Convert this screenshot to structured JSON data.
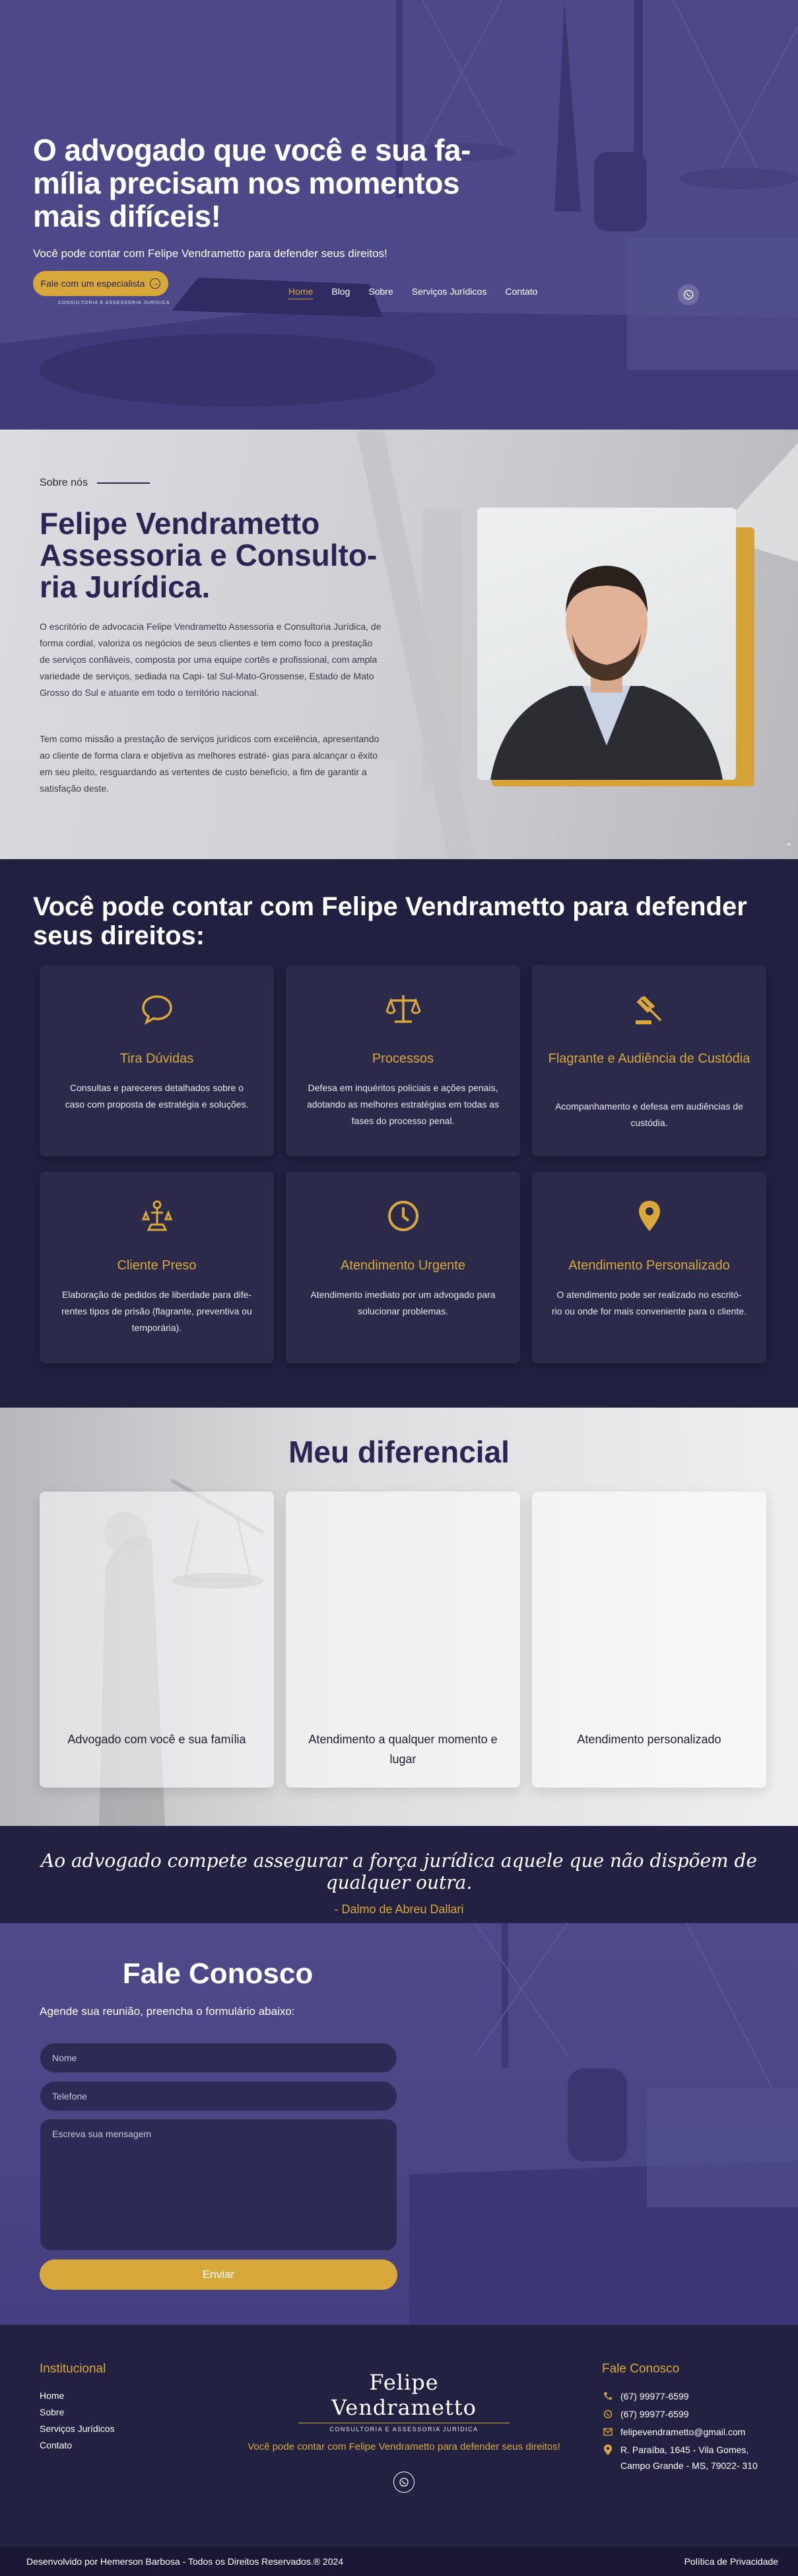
{
  "hero": {
    "title": "O advogado que você e sua fa- mília precisam nos momentos mais difíceis!",
    "subtitle": "Você pode contar com Felipe Vendrametto para defender seus direitos!",
    "cta": "Fale com um especialista",
    "logo_tagline": "CONSULTORIA E ASSESSORIA JURÍDICA",
    "nav": [
      "Home",
      "Blog",
      "Sobre",
      "Serviços Jurídicos",
      "Contato"
    ]
  },
  "about": {
    "label": "Sobre nós",
    "title": "Felipe Vendrametto Assessoria e Consulto- ria Jurídica.",
    "p1": "O escritório de advocacia Felipe Vendrametto Assessoria e Consultoria Jurídica, de forma cordial, valoriza os negócios de seus clientes e tem como foco a prestação de serviços confiáveis, composta por uma equipe cortês e profissional, com ampla variedade de serviços, sediada na Capi- tal Sul-Mato-Grossense, Estado de Mato Grosso do Sul e atuante em todo o território nacional.",
    "p2": "Tem como missão a prestação de serviços jurídicos com excelência, apresentando ao cliente de forma clara e objetiva as melhores estraté- gias para alcançar o êxito em seu pleito, resguardando as vertentes de custo benefício, a fim de garantir a satisfação deste."
  },
  "services": {
    "title": "Você pode contar com Felipe Vendrametto para defender seus direitos:",
    "items": [
      {
        "icon": "chat-bubble-icon",
        "title": "Tira Dúvidas",
        "desc": "Consultas e pareceres detalhados sobre o caso com proposta de estratégia e soluções."
      },
      {
        "icon": "scales-icon",
        "title": "Processos",
        "desc": "Defesa em inquéritos policiais e ações penais, adotando as melhores estratégias em todas as fases do processo penal."
      },
      {
        "icon": "gavel-icon",
        "title": "Flagrante e Audiência de Custódia",
        "desc": "Acompanhamento e defesa em audiências de custódia."
      },
      {
        "icon": "justice-figure-icon",
        "title": "Cliente Preso",
        "desc": "Elaboração de pedidos de liberdade para dife- rentes tipos de prisão (flagrante, preventiva ou temporária)."
      },
      {
        "icon": "clock-icon",
        "title": "Atendimento Urgente",
        "desc": "Atendimento imediato por um advogado para solucionar problemas."
      },
      {
        "icon": "location-pin-icon",
        "title": "Atendimento Personalizado",
        "desc": "O atendimento pode ser realizado no escritó- rio ou onde for mais conveniente para o cliente."
      }
    ]
  },
  "diferencial": {
    "title": "Meu diferencial",
    "cards": [
      "Advogado com você e sua família",
      "Atendimento a qualquer momento e lugar",
      "Atendimento personalizado"
    ]
  },
  "quote": {
    "text": "Ao advogado compete assegurar a força jurídica aquele que não dispõem de qualquer outra.",
    "author": "- Dalmo de Abreu Dallari"
  },
  "contact": {
    "title": "Fale Conosco",
    "subtitle": "Agende sua reunião, preencha o formulário abaixo:",
    "name_placeholder": "Nome",
    "phone_placeholder": "Telefone",
    "message_placeholder": "Escreva sua mensagem",
    "send": "Enviar"
  },
  "footer": {
    "inst_title": "Institucional",
    "links": [
      "Home",
      "Sobre",
      "Serviços Jurídicos",
      "Contato"
    ],
    "logo_name": "Felipe Vendrametto",
    "logo_tagline": "CONSULTORIA E ASSESSORIA JURÍDICA",
    "tagline": "Você pode contar com Felipe Vendrametto para defender seus direitos!",
    "contact_title": "Fale Conosco",
    "phone1": "(67) 99977-6599",
    "phone2": "(67) 99977-6599",
    "email": "felipevendrametto@gmail.com",
    "address": "R. Paraíba, 1645 - Vila Gomes, Campo Grande - MS, 79022- 310"
  },
  "bottom": {
    "credits": "Desenvolvido por Hemerson Barbosa - Todos os Direitos Reservados.® 2024",
    "privacy": "Política de Privacidade"
  },
  "colors": {
    "primary": "#232142",
    "accent": "#d8a93a",
    "hero": "#4e4a8a"
  }
}
